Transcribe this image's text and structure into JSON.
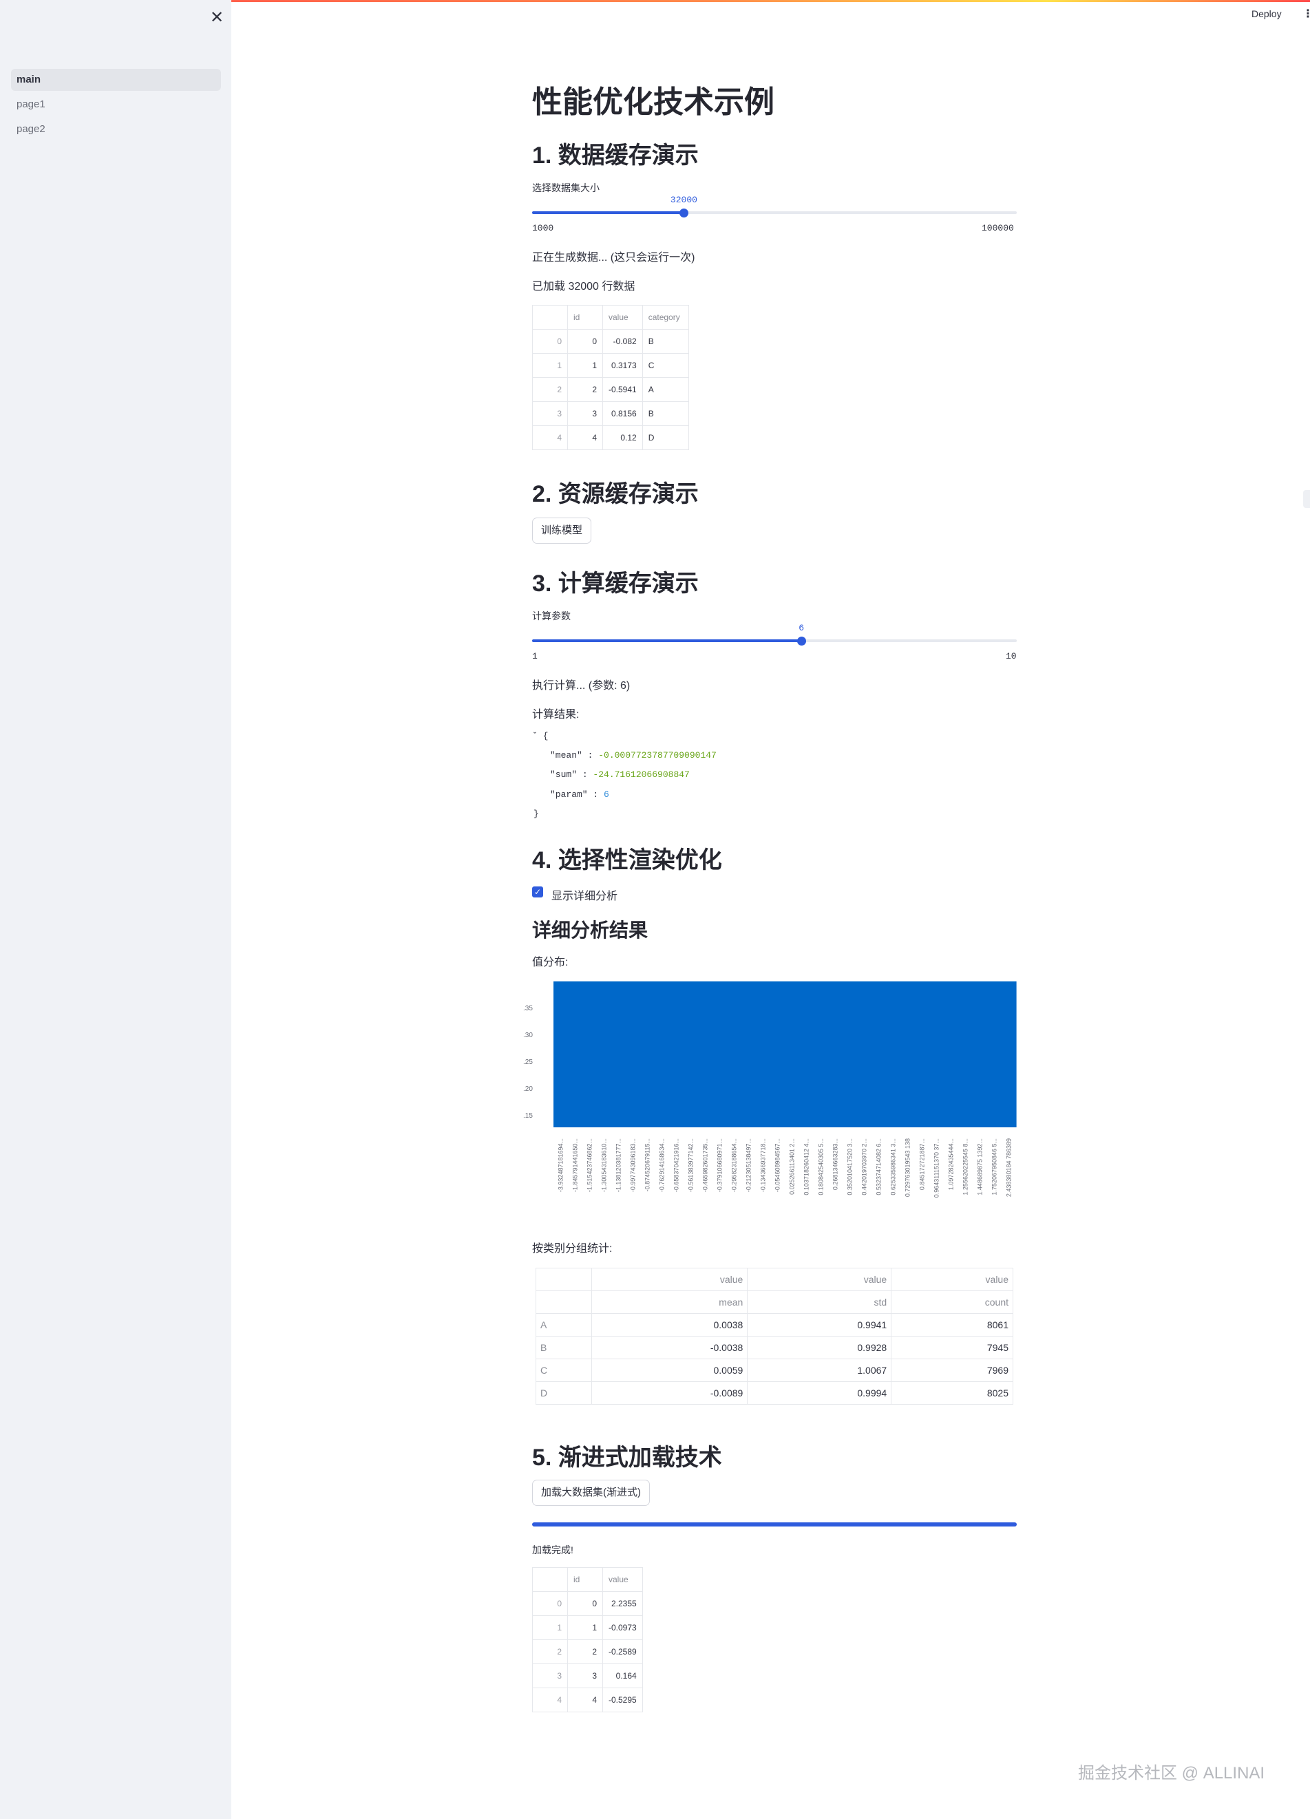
{
  "app": {
    "deploy_label": "Deploy",
    "menu_icon": "kebab-menu-icon",
    "close_icon": "close-icon"
  },
  "sidebar": {
    "items": [
      {
        "label": "main",
        "active": true
      },
      {
        "label": "page1",
        "active": false
      },
      {
        "label": "page2",
        "active": false
      }
    ]
  },
  "page": {
    "title": "性能优化技术示例"
  },
  "section1": {
    "heading": "1. 数据缓存演示",
    "slider_label": "选择数据集大小",
    "slider_value": "32000",
    "slider_min": "1000",
    "slider_max": "100000",
    "slider_fraction": 0.3131,
    "status": "正在生成数据... (这只会运行一次)",
    "loaded": "已加载 32000 行数据",
    "table": {
      "columns": [
        "",
        "id",
        "value",
        "category"
      ],
      "rows": [
        [
          "0",
          "0",
          "-0.082",
          "B"
        ],
        [
          "1",
          "1",
          "0.3173",
          "C"
        ],
        [
          "2",
          "2",
          "-0.5941",
          "A"
        ],
        [
          "3",
          "3",
          "0.8156",
          "B"
        ],
        [
          "4",
          "4",
          "0.12",
          "D"
        ]
      ]
    }
  },
  "section2": {
    "heading": "2. 资源缓存演示",
    "button": "训练模型"
  },
  "section3": {
    "heading": "3. 计算缓存演示",
    "slider_label": "计算参数",
    "slider_value": "6",
    "slider_min": "1",
    "slider_max": "10",
    "slider_fraction": 0.5556,
    "status": "执行计算... (参数: 6)",
    "result_label": "计算结果:",
    "json": {
      "mean_key": "\"mean\"",
      "mean_val": "-0.0007723787709090147",
      "sum_key": "\"sum\"",
      "sum_val": "-24.71612066908847",
      "param_key": "\"param\"",
      "param_val": "6"
    }
  },
  "section4": {
    "heading": "4. 选择性渲染优化",
    "checkbox_label": "显示详细分析",
    "checkbox_checked": true,
    "subheading": "详细分析结果",
    "dist_label": "值分布:",
    "group_label": "按类别分组统计:",
    "group_table": {
      "header1": [
        "",
        "value",
        "value",
        "value"
      ],
      "header2": [
        "",
        "mean",
        "std",
        "count"
      ],
      "rows": [
        [
          "A",
          "0.0038",
          "0.9941",
          "8061"
        ],
        [
          "B",
          "-0.0038",
          "0.9928",
          "7945"
        ],
        [
          "C",
          "0.0059",
          "1.0067",
          "7969"
        ],
        [
          "D",
          "-0.0089",
          "0.9994",
          "8025"
        ]
      ]
    }
  },
  "chart_data": {
    "type": "bar",
    "ytick_labels": [
      ".35",
      ".30",
      ".25",
      ".20",
      ".15"
    ],
    "xtick_labels": [
      "-3.932487181694...",
      "-1.845791441650...",
      "-1.515423746862...",
      "-1.300543183610...",
      "-1.138120381777...",
      "-0.997743096183...",
      "-0.874520679115...",
      "-0.762914168634...",
      "-0.658370421916...",
      "-0.561383977142...",
      "-0.465982601735...",
      "-0.379106680971...",
      "-0.295823188654...",
      "-0.212305138497...",
      "-0.134366937718...",
      "-0.054608984567...",
      "0.025266113401 2...",
      "0.103718260412 4...",
      "0.180842540305 5...",
      "0.268134663283...",
      "0.352010417520 3...",
      "0.442019703970 2...",
      "0.532374714082 6...",
      "0.625335986341 3...",
      "0.729763019543 138",
      "0.845172721887...",
      "0.964311151370 37...",
      "1.097282435444...",
      "1.255620225545 8...",
      "1.448689875 1392...",
      "1.752067950846 5...",
      "2.438380184 786389"
    ],
    "bar_color": "#0068c9"
  },
  "section5": {
    "heading": "5. 渐进式加载技术",
    "button": "加载大数据集(渐进式)",
    "progress": 1.0,
    "status": "加载完成!",
    "table": {
      "columns": [
        "",
        "id",
        "value"
      ],
      "rows": [
        [
          "0",
          "0",
          "2.2355"
        ],
        [
          "1",
          "1",
          "-0.0973"
        ],
        [
          "2",
          "2",
          "-0.2589"
        ],
        [
          "3",
          "3",
          "0.164"
        ],
        [
          "4",
          "4",
          "-0.5295"
        ]
      ]
    }
  },
  "watermark": "掘金技术社区 @ ALLINAI"
}
